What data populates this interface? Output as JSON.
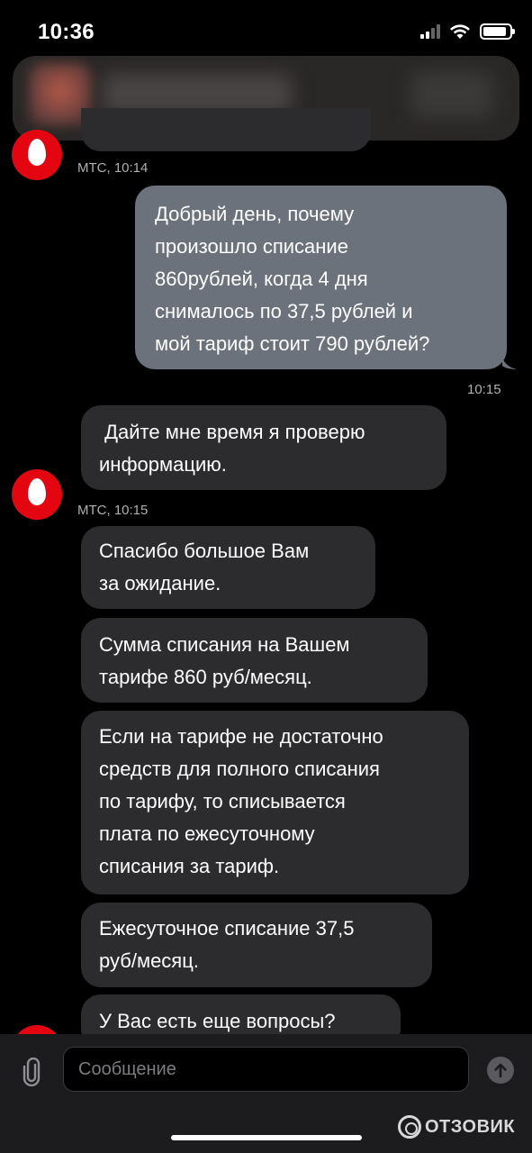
{
  "status_bar": {
    "time": "10:36"
  },
  "chat": {
    "messages": [
      {
        "sender": "МТС",
        "meta": "МТС, 10:14"
      },
      {
        "lines": [
          "Добрый день, почему",
          "произошло списание",
          "860рублей, когда 4 дня",
          "снималось по 37,5 рублей и",
          "мой тариф стоит 790 рублей?"
        ],
        "time": "10:15"
      },
      {
        "lines": [
          " Дайте мне время я проверю",
          "информацию."
        ],
        "meta": "МТС, 10:15"
      },
      {
        "lines": [
          "Спасибо большое Вам",
          "за ожидание."
        ]
      },
      {
        "lines": [
          "Сумма списания на Вашем",
          "тарифе 860 руб/месяц."
        ]
      },
      {
        "lines": [
          "Если на тарифе не достаточно",
          "средств для полного списания",
          "по тарифу, то списывается",
          "плата по ежесуточному",
          "списания за тариф."
        ]
      },
      {
        "lines": [
          "Ежесуточное списание 37,5",
          "руб/месяц."
        ]
      },
      {
        "lines": [
          "У Вас есть еще вопросы?"
        ]
      }
    ]
  },
  "composer": {
    "placeholder": "Сообщение"
  },
  "watermark": {
    "text": "ОТЗОВИК"
  },
  "colors": {
    "mts_red": "#e30611",
    "outgoing_bubble": "#6c727c",
    "incoming_bubble": "#2c2c2e"
  }
}
